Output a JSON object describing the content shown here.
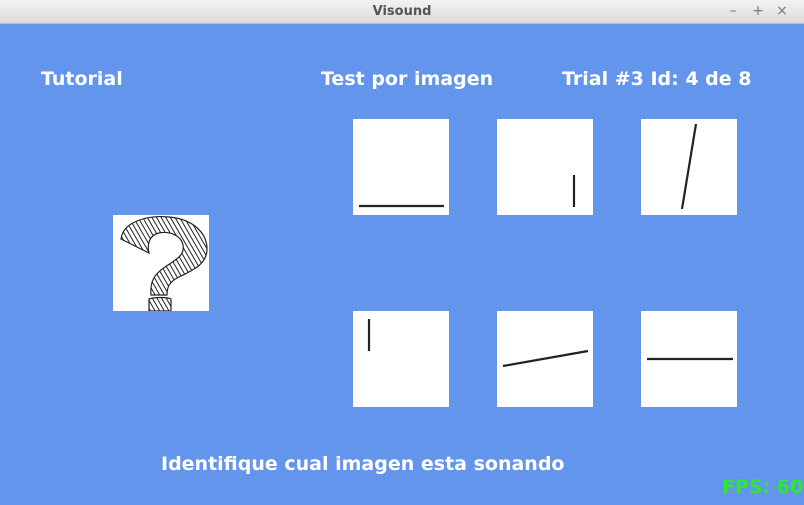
{
  "window": {
    "title": "Visound",
    "controls": {
      "minimize": "–",
      "maximize": "+",
      "close": "×"
    }
  },
  "header": {
    "mode_label": "Tutorial",
    "test_label": "Test por imagen",
    "trial_label": "Trial #3 Id: 4 de 8"
  },
  "query_image": {
    "icon": "question-mark-icon"
  },
  "options": [
    {
      "icon": "horizontal-line-bottom-icon"
    },
    {
      "icon": "short-vertical-line-right-icon"
    },
    {
      "icon": "tilted-line-icon"
    },
    {
      "icon": "short-vertical-line-left-icon"
    },
    {
      "icon": "ascending-line-icon"
    },
    {
      "icon": "horizontal-line-middle-icon"
    }
  ],
  "instruction": "Identifique cual imagen esta sonando",
  "fps_label": "FPS: 60"
}
